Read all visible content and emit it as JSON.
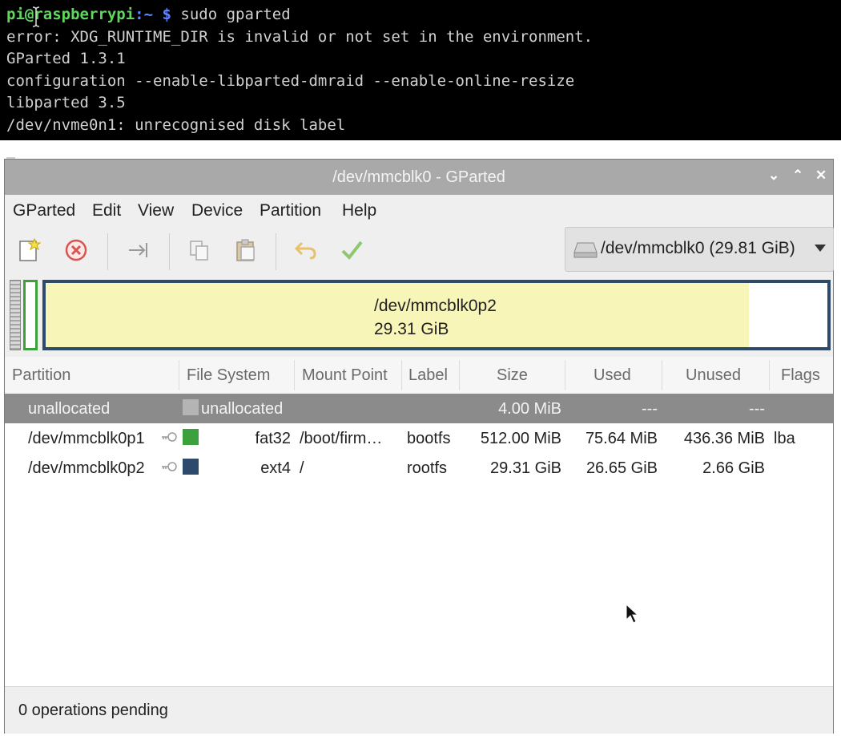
{
  "terminal": {
    "prompt_user": "pi@raspberrypi",
    "prompt_path": ":~",
    "prompt_symbol": "$",
    "command": "sudo gparted",
    "lines": [
      "error: XDG_RUNTIME_DIR is invalid or not set in the environment.",
      "GParted 1.3.1",
      "configuration --enable-libparted-dmraid --enable-online-resize",
      "libparted 3.5",
      "/dev/nvme0n1: unrecognised disk label"
    ]
  },
  "window": {
    "title": "/dev/mmcblk0 - GParted",
    "controls": [
      "⌄",
      "⌃",
      "✕"
    ]
  },
  "menu": [
    "GParted",
    "Edit",
    "View",
    "Device",
    "Partition",
    "Help"
  ],
  "toolbar": {
    "icons": [
      "new-partition-icon",
      "delete-icon",
      "resize-move-icon",
      "copy-icon",
      "paste-icon",
      "undo-icon",
      "apply-icon"
    ],
    "device_label": "/dev/mmcblk0 (29.81 GiB)"
  },
  "diskmap": {
    "main_name": "/dev/mmcblk0p2",
    "main_size": "29.31 GiB",
    "main_used_fraction": 0.9,
    "colors": {
      "fat32": "#3ca03c",
      "ext4": "#2e4a6b",
      "unallocated": "#a9a9a9",
      "used_fill": "#f7f6b8"
    }
  },
  "table": {
    "headers": [
      "Partition",
      "File System",
      "Mount Point",
      "Label",
      "Size",
      "Used",
      "Unused",
      "Flags"
    ],
    "rows": [
      {
        "partition": "unallocated",
        "filesystem": "unallocated",
        "mount": "",
        "label": "",
        "size": "4.00 MiB",
        "used": "---",
        "unused": "---",
        "flags": "",
        "color": "#a9a9a9"
      },
      {
        "partition": "/dev/mmcblk0p1",
        "filesystem": "fat32",
        "mount": "/boot/firm…",
        "label": "bootfs",
        "size": "512.00 MiB",
        "used": "75.64 MiB",
        "unused": "436.36 MiB",
        "flags": "lba",
        "color": "#3ca03c"
      },
      {
        "partition": "/dev/mmcblk0p2",
        "filesystem": "ext4",
        "mount": "/",
        "label": "rootfs",
        "size": "29.31 GiB",
        "used": "26.65 GiB",
        "unused": "2.66 GiB",
        "flags": "",
        "color": "#2e4a6b"
      }
    ]
  },
  "status": "0 operations pending"
}
